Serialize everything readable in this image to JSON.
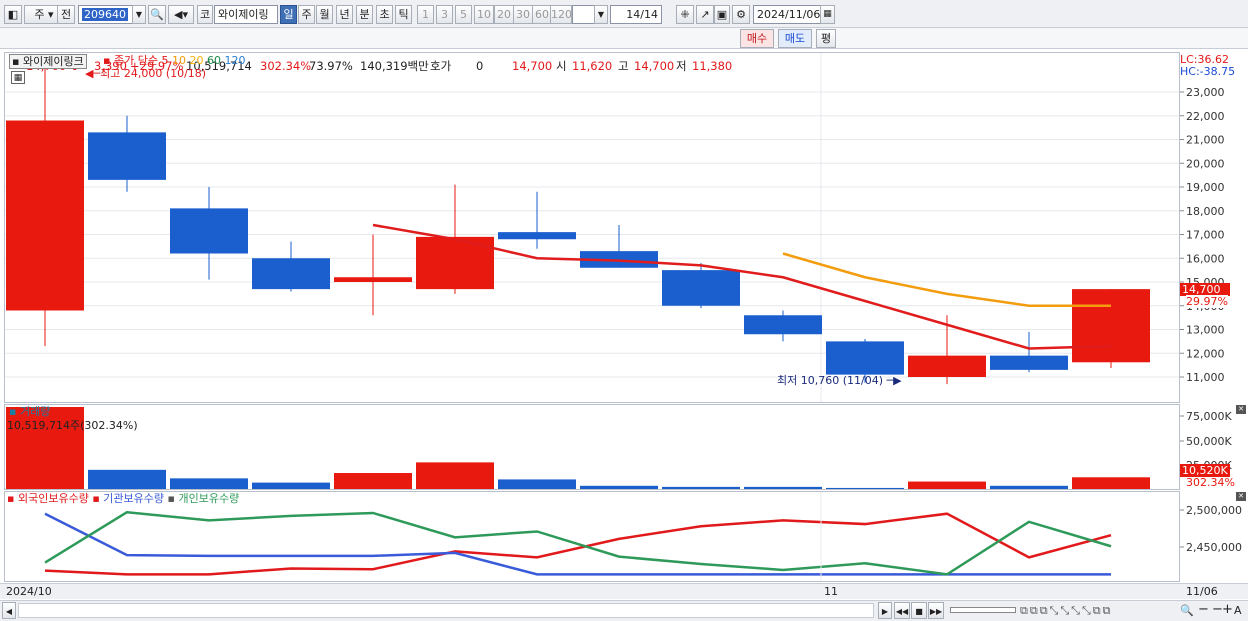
{
  "toolbar": {
    "market": "주",
    "prev": "전",
    "code": "209640",
    "name_button": "코",
    "stock_name": "와이제이링",
    "periods": [
      "일",
      "주",
      "월",
      "년",
      "분",
      "초",
      "틱"
    ],
    "ticks": [
      "1",
      "3",
      "5",
      "10",
      "20",
      "30",
      "60",
      "120"
    ],
    "count": "14/14",
    "date": "2024/11/06"
  },
  "quote": {
    "price": "14,700",
    "change": "3,390",
    "rate": "+29.97%",
    "volume": "10,519,714",
    "vol_ratio": "302.34%",
    "turnover": "73.97%",
    "amount": "140,319백만",
    "hoga_label": "호가",
    "hoga": "0",
    "hoga_price": "14,700",
    "open_label": "시",
    "open": "11,620",
    "high_label": "고",
    "high": "14,700",
    "low_label": "저",
    "low": "11,380",
    "buy": "매수",
    "sell": "매도",
    "eval": "평"
  },
  "legend": {
    "stock": "와이제이링크",
    "ma_label": "종가 단순",
    "ma": [
      "5",
      "10",
      "20",
      "60",
      "120"
    ],
    "max": "최고 24,000 (10/18)",
    "min": "최저 10,760 (11/04)",
    "lc": "LC:36.62",
    "hc": "HC:-38.75",
    "last": "14,700",
    "last_rate": "29.97%"
  },
  "volume_panel": {
    "title": "거래량",
    "readout": "10,519,714주(302.34%)",
    "last": "10,520K",
    "last_rate": "302.34%"
  },
  "ownership": {
    "series": [
      "외국인보유수량",
      "기관보유수량",
      "개인보유수량"
    ]
  },
  "xaxis": {
    "start": "2024/10",
    "mid": "11",
    "end": "11/06"
  },
  "colors": {
    "up": "#e8190f",
    "down": "#1b5fcf",
    "ma5": "#e01c1c",
    "ma10": "#f39c0d"
  },
  "chart_data": [
    {
      "type": "candlestick",
      "title": "",
      "y_ticks": [
        "23,000",
        "22,000",
        "21,000",
        "20,000",
        "19,000",
        "18,000",
        "17,000",
        "16,000",
        "15,000",
        "14,000",
        "13,000",
        "12,000",
        "11,000"
      ],
      "candles": [
        {
          "o": 13800,
          "h": 24000,
          "l": 12300,
          "c": 21800,
          "up": true
        },
        {
          "o": 21300,
          "h": 22000,
          "l": 18800,
          "c": 19300,
          "up": false
        },
        {
          "o": 18100,
          "h": 19000,
          "l": 15100,
          "c": 16200,
          "up": false
        },
        {
          "o": 16000,
          "h": 16700,
          "l": 14600,
          "c": 14700,
          "up": false
        },
        {
          "o": 15000,
          "h": 17000,
          "l": 13600,
          "c": 15200,
          "up": true
        },
        {
          "o": 14700,
          "h": 19100,
          "l": 14500,
          "c": 16900,
          "up": true
        },
        {
          "o": 17100,
          "h": 18800,
          "l": 16400,
          "c": 16800,
          "up": false
        },
        {
          "o": 16300,
          "h": 17400,
          "l": 15600,
          "c": 15600,
          "up": false
        },
        {
          "o": 15500,
          "h": 15800,
          "l": 13900,
          "c": 14000,
          "up": false
        },
        {
          "o": 13600,
          "h": 13800,
          "l": 12500,
          "c": 12800,
          "up": false
        },
        {
          "o": 12500,
          "h": 12600,
          "l": 10760,
          "c": 11100,
          "up": false
        },
        {
          "o": 11000,
          "h": 13600,
          "l": 10700,
          "c": 11900,
          "up": true
        },
        {
          "o": 11900,
          "h": 12900,
          "l": 11200,
          "c": 11300,
          "up": false
        },
        {
          "o": 11620,
          "h": 14700,
          "l": 11380,
          "c": 14700,
          "up": true
        }
      ],
      "ma5": [
        null,
        null,
        null,
        null,
        17400,
        16800,
        16000,
        15900,
        15700,
        15200,
        14200,
        13200,
        12200,
        12300
      ],
      "ma10": [
        null,
        null,
        null,
        null,
        null,
        null,
        null,
        null,
        null,
        16200,
        15200,
        14500,
        14000,
        14000
      ],
      "ylim": [
        10500,
        24000
      ]
    },
    {
      "type": "bar",
      "title": "거래량",
      "values": [
        77,
        18,
        10,
        6,
        15,
        25,
        9,
        3,
        2,
        2,
        1,
        7,
        3,
        11
      ],
      "colors": [
        "up",
        "down",
        "down",
        "down",
        "up",
        "up",
        "down",
        "down",
        "down",
        "down",
        "down",
        "up",
        "down",
        "up"
      ],
      "y_ticks": [
        "75,000K",
        "50,000K",
        "25,000K"
      ]
    },
    {
      "type": "line",
      "title": "",
      "y_ticks": [
        "2,500,000",
        "2,450,000"
      ],
      "series": [
        {
          "name": "외국인보유수량",
          "values": [
            2418,
            2413,
            2413,
            2421,
            2420,
            2444,
            2436,
            2461,
            2478,
            2486,
            2481,
            2495,
            2436,
            2466
          ]
        },
        {
          "name": "기관보유수량",
          "values": [
            2495,
            2439,
            2438,
            2438,
            2438,
            2442,
            2413,
            2413,
            2413,
            2413,
            2413,
            2413,
            2413,
            2413
          ]
        },
        {
          "name": "개인보유수량",
          "values": [
            2429,
            2497,
            2486,
            2492,
            2496,
            2463,
            2471,
            2437,
            2427,
            2419,
            2428,
            2413,
            2484,
            2451
          ]
        }
      ]
    }
  ]
}
